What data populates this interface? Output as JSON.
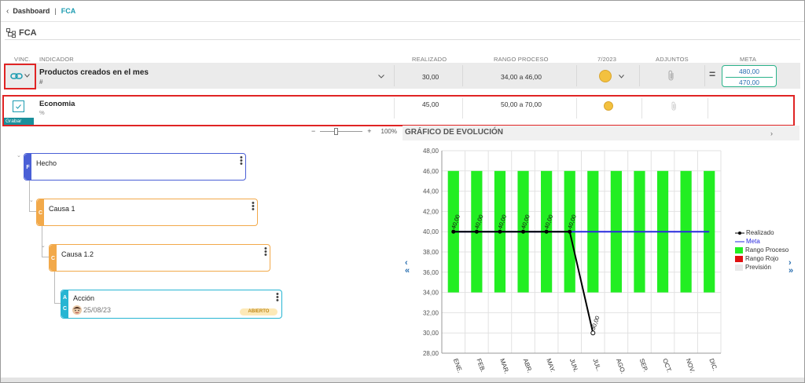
{
  "breadcrumb": {
    "back": "Dashboard",
    "current": "FCA"
  },
  "section": {
    "title": "FCA"
  },
  "table": {
    "headers": {
      "vinc": "VINC.",
      "indicador": "INDICADOR",
      "realizado": "REALIZADO",
      "rango": "RANGO PROCESO",
      "periodo": "7/2023",
      "adjuntos": "ADJUNTOS",
      "meta": "META"
    },
    "row_main": {
      "name": "Productos creados en el mes",
      "unit": "#",
      "realizado": "30,00",
      "rango": "34,00 a 46,00",
      "meta_top": "480,00",
      "meta_bottom": "470,00",
      "equals": "="
    },
    "row_sub": {
      "name": "Economia",
      "unit": "%",
      "realizado": "45,00",
      "rango": "50,00 a 70,00"
    },
    "save_label": "Grabar"
  },
  "zoom": {
    "minus": "−",
    "plus": "+",
    "level": "100%"
  },
  "tree": {
    "nodes": [
      {
        "tag": "F",
        "title": "Hecho",
        "color": "#4a5fd6"
      },
      {
        "tag": "C",
        "title": "Causa 1",
        "color": "#f2a94a"
      },
      {
        "tag": "C",
        "title": "Causa 1.2",
        "color": "#f2a94a"
      },
      {
        "tag_top": "A",
        "tag_bottom": "C",
        "title": "Acción",
        "date": "25/08/23",
        "status": "ABIERTO",
        "color": "#27b5d3"
      }
    ]
  },
  "chart_panel": {
    "title": "GRÁFICO DE EVOLUCIÓN"
  },
  "chart_data": {
    "type": "bar",
    "categories": [
      "ENE.",
      "FEB.",
      "MAR.",
      "ABR.",
      "MAY.",
      "JUN.",
      "JUL.",
      "AGO.",
      "SEP.",
      "OCT.",
      "NOV.",
      "DIC."
    ],
    "ylim": [
      28,
      48
    ],
    "yticks": [
      "28,00",
      "30,00",
      "32,00",
      "34,00",
      "36,00",
      "38,00",
      "40,00",
      "42,00",
      "44,00",
      "46,00",
      "48,00"
    ],
    "rango_proceso": {
      "low": 34,
      "high": 46,
      "color": "#22ee22"
    },
    "realizado": {
      "values": [
        40,
        40,
        40,
        40,
        40,
        40,
        30
      ],
      "labels": [
        "40,00",
        "40,00",
        "40,00",
        "40,00",
        "40,00",
        "40,00",
        "30,00"
      ],
      "color": "#000000"
    },
    "meta": {
      "value": 40,
      "color": "#2a2adf"
    },
    "legend": [
      {
        "name": "Realizado",
        "color": "#000000"
      },
      {
        "name": "Meta",
        "color": "#2a2adf"
      },
      {
        "name": "Rango Proceso",
        "color": "#22ee22"
      },
      {
        "name": "Rango Rojo",
        "color": "#e01010"
      },
      {
        "name": "Previsión",
        "color": "#e8e8e8"
      }
    ]
  }
}
